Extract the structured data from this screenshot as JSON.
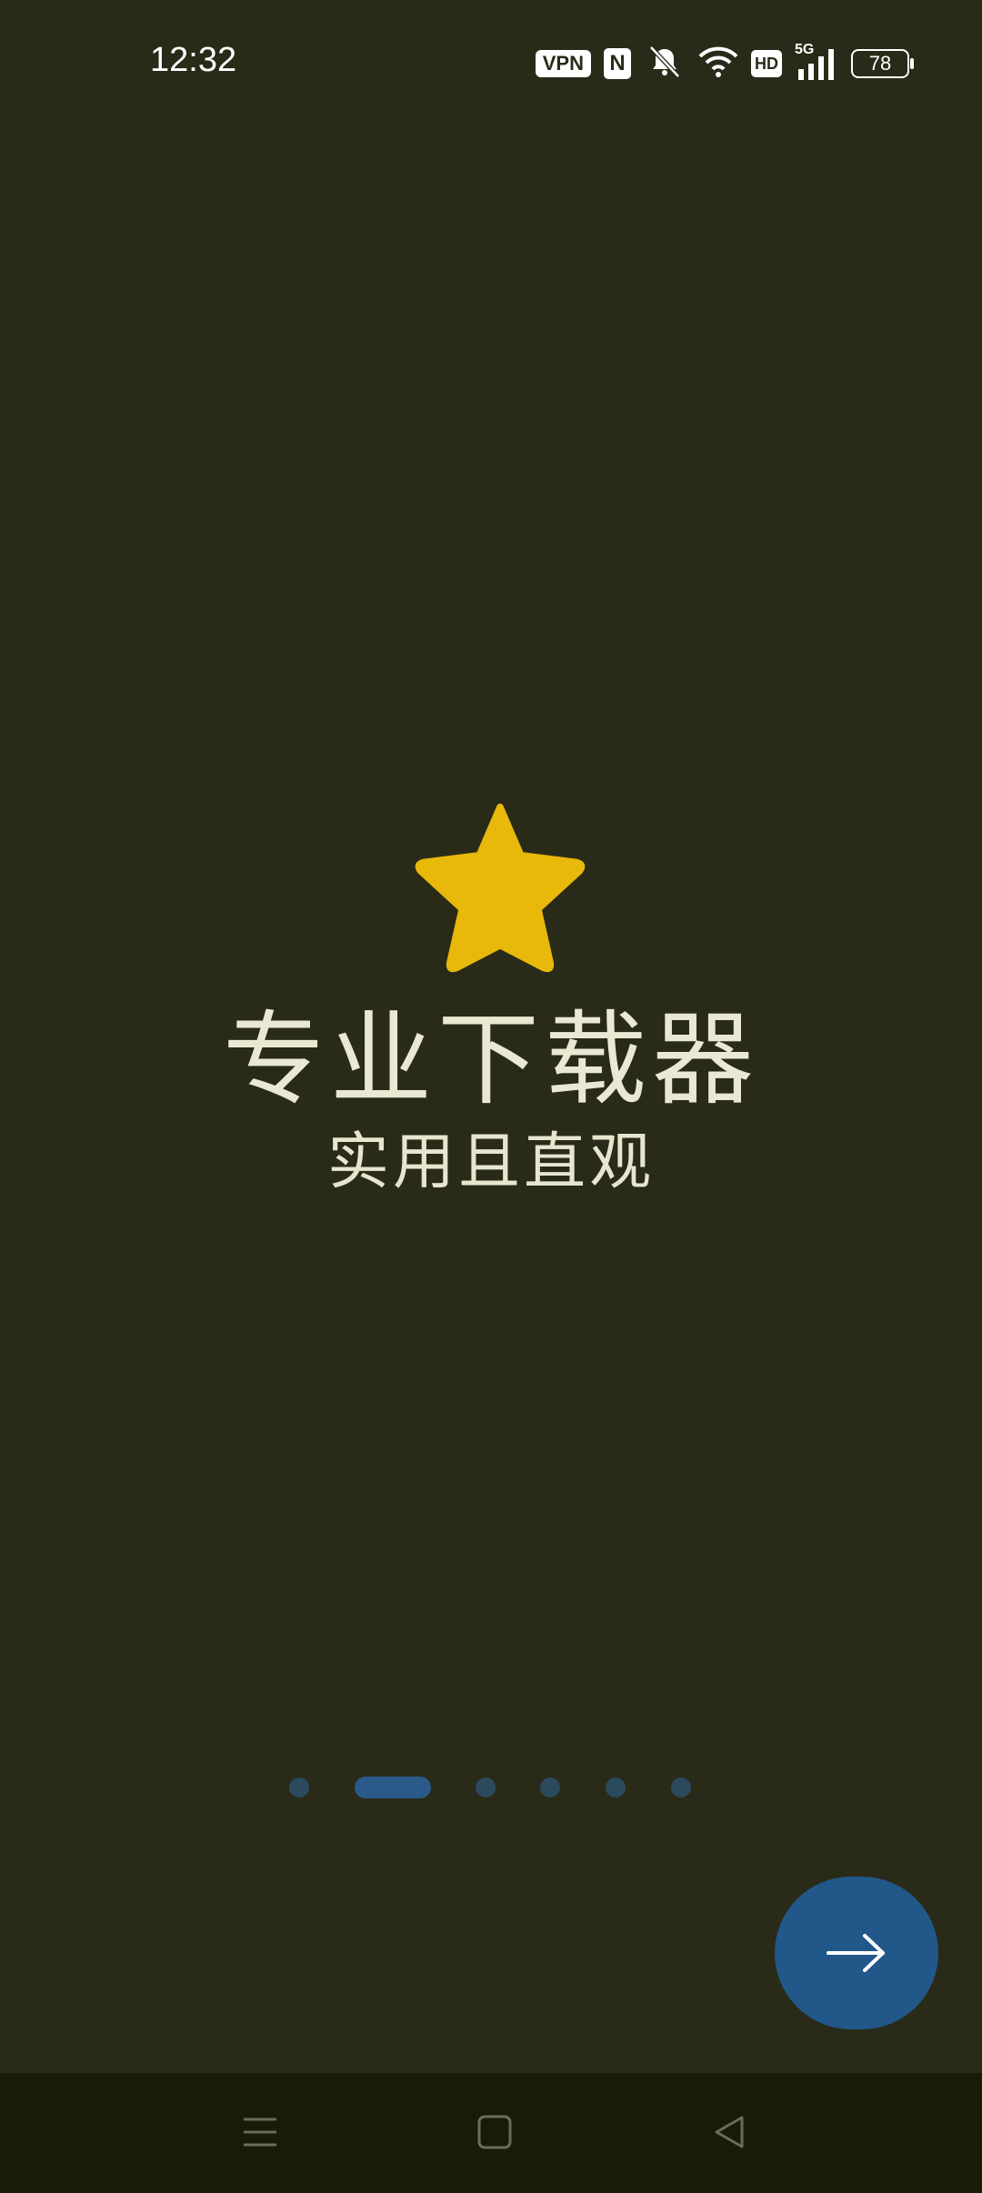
{
  "status_bar": {
    "time": "12:32",
    "vpn_label": "VPN",
    "nfc_label": "N",
    "hd_label": "HD",
    "network": "5G",
    "battery": "78"
  },
  "onboarding": {
    "icon": "star-icon",
    "title": "专业下载器",
    "subtitle": "实用且直观",
    "page_count": 6,
    "current_page_index": 1
  },
  "next_button": {
    "icon": "arrow-right-icon"
  },
  "nav_bar": {
    "menu_icon": "menu-icon",
    "home_icon": "home-icon",
    "back_icon": "back-icon"
  },
  "colors": {
    "background": "#292b18",
    "accent": "#22578a",
    "star": "#e8b80a",
    "text": "#e6e6cf",
    "dot_inactive": "#2b4a5e",
    "nav_bar": "#1a1b07"
  }
}
